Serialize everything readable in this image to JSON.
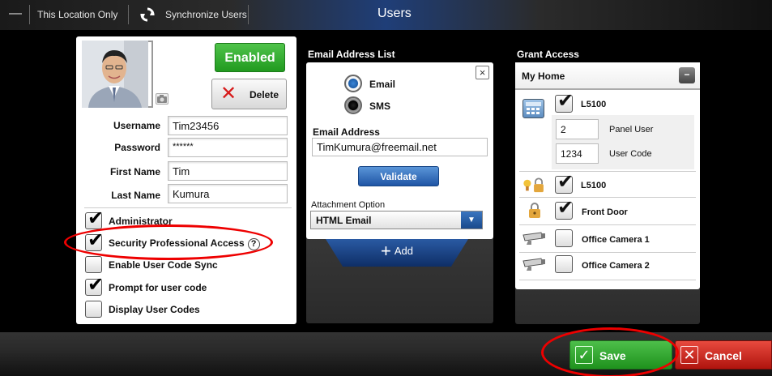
{
  "topbar": {
    "location_label": "This Location Only",
    "sync_label": "Synchronize Users",
    "title": "Users"
  },
  "user": {
    "status_button": "Enabled",
    "delete_button": "Delete",
    "fields": [
      {
        "label": "Username",
        "value": "Tim23456"
      },
      {
        "label": "Password",
        "value": "******"
      },
      {
        "label": "First Name",
        "value": "Tim"
      },
      {
        "label": "Last Name",
        "value": "Kumura"
      }
    ],
    "options": [
      {
        "label": "Administrator",
        "checked": true
      },
      {
        "label": "Security Professional Access",
        "checked": true
      },
      {
        "label": "Enable User Code Sync",
        "checked": false
      },
      {
        "label": "Prompt for user code",
        "checked": true
      },
      {
        "label": "Display User Codes",
        "checked": false
      }
    ],
    "help_glyph": "?"
  },
  "email": {
    "heading": "Email Address List",
    "close_glyph": "×",
    "radio_email": "Email",
    "radio_sms": "SMS",
    "address_label": "Email Address",
    "address_value": "TimKumura@freemail.net",
    "validate_button": "Validate",
    "attachment_label": "Attachment Option",
    "attachment_value": "HTML Email",
    "add_label": "Add"
  },
  "grant": {
    "heading": "Grant Access",
    "location": "My Home",
    "collapse_glyph": "−",
    "panel_device": "L5100",
    "panel_user_value": "2",
    "panel_user_label": "Panel User",
    "user_code_value": "1234",
    "user_code_label": "User Code",
    "devices": [
      {
        "label": "L5100",
        "checked": true
      },
      {
        "label": "Front Door",
        "checked": true
      },
      {
        "label": "Office Camera 1",
        "checked": false
      },
      {
        "label": "Office Camera 2",
        "checked": false
      }
    ]
  },
  "footer": {
    "save_button": "Save",
    "cancel_button": "Cancel"
  },
  "colors": {
    "enabled_green": "#2aa826",
    "validate_blue": "#1f55a5",
    "cancel_red": "#c8211a",
    "annotation_red": "#e00000"
  }
}
